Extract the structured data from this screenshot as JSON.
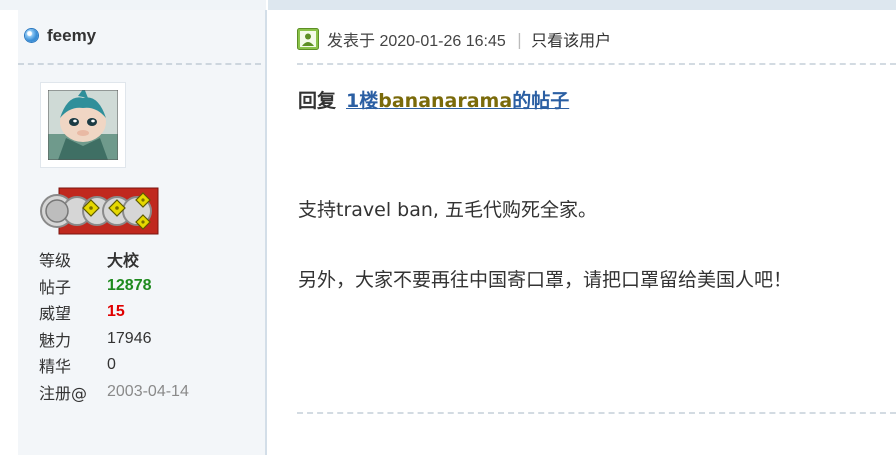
{
  "user": {
    "name": "feemy",
    "stats": [
      {
        "label": "等级",
        "value": "大校"
      },
      {
        "label": "帖子",
        "value": "12878"
      },
      {
        "label": "威望",
        "value": "15"
      },
      {
        "label": "魅力",
        "value": "17946"
      },
      {
        "label": "精华",
        "value": "0"
      },
      {
        "label": "注册@",
        "value": "2003-04-14"
      }
    ]
  },
  "post": {
    "posted_label": "发表于 2020-01-26 16:45",
    "divider": "|",
    "only_user": "只看该用户",
    "reply_prefix": "回复",
    "reply_floor": "1楼",
    "reply_user": "bananarama",
    "reply_suffix": "的帖子",
    "paragraphs": [
      "支持travel ban, 五毛代购死全家。",
      "另外，大家不要再往中国寄口罩，请把口罩留给美国人吧！"
    ]
  },
  "colors": {
    "posts_value": "#1e8a1e",
    "prestige_value": "#e00000",
    "link": "#2b5fa3",
    "sidebar_bg": "#f3f6f9"
  }
}
